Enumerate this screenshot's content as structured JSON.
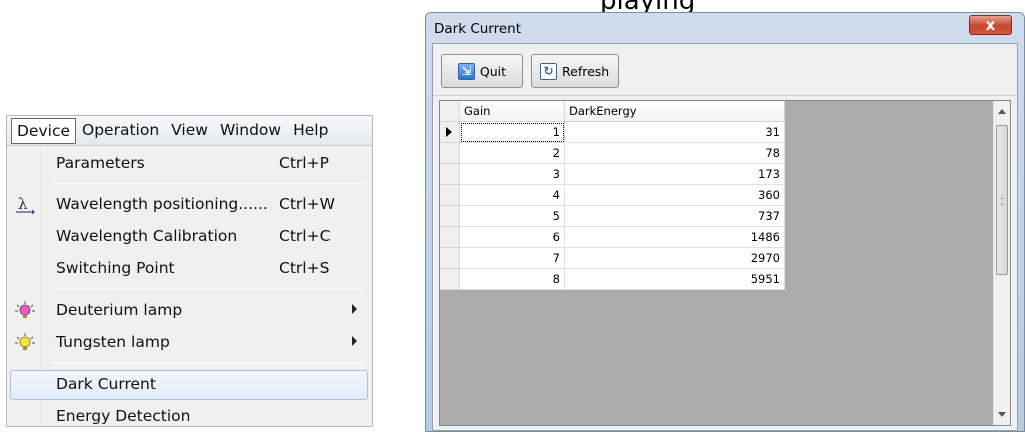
{
  "top_text": "playing",
  "menu": {
    "menubar": [
      "Device",
      "Operation",
      "View",
      "Window",
      "Help"
    ],
    "items": [
      {
        "label": "Parameters",
        "shortcut": "Ctrl+P"
      },
      {
        "label": "Wavelength positioning......",
        "shortcut": "Ctrl+W"
      },
      {
        "label": "Wavelength Calibration",
        "shortcut": "Ctrl+C"
      },
      {
        "label": "Switching Point",
        "shortcut": "Ctrl+S"
      },
      {
        "label": "Deuterium lamp"
      },
      {
        "label": "Tungsten lamp"
      },
      {
        "label": "Dark Current"
      },
      {
        "label": "Energy Detection"
      }
    ]
  },
  "dialog": {
    "title": "Dark Current",
    "close_label": "x",
    "buttons": {
      "quit": "Quit",
      "refresh": "Refresh"
    },
    "columns": [
      "Gain",
      "DarkEnergy"
    ],
    "rows": [
      {
        "gain": "1",
        "dark": "31"
      },
      {
        "gain": "2",
        "dark": "78"
      },
      {
        "gain": "3",
        "dark": "173"
      },
      {
        "gain": "4",
        "dark": "360"
      },
      {
        "gain": "5",
        "dark": "737"
      },
      {
        "gain": "6",
        "dark": "1486"
      },
      {
        "gain": "7",
        "dark": "2970"
      },
      {
        "gain": "8",
        "dark": "5951"
      }
    ]
  },
  "colors": {
    "highlight_border": "#a9c2e2",
    "dialog_frame": "#b9cbe1",
    "close_red": "#c7452b",
    "grid_background": "#ababab"
  },
  "icons": {
    "wavelength_positioning": "lambda-arrow-icon",
    "deuterium_lamp": "pink-bulb-icon",
    "tungsten_lamp": "yellow-bulb-icon",
    "quit": "run-exit-icon",
    "refresh": "refresh-icon"
  }
}
